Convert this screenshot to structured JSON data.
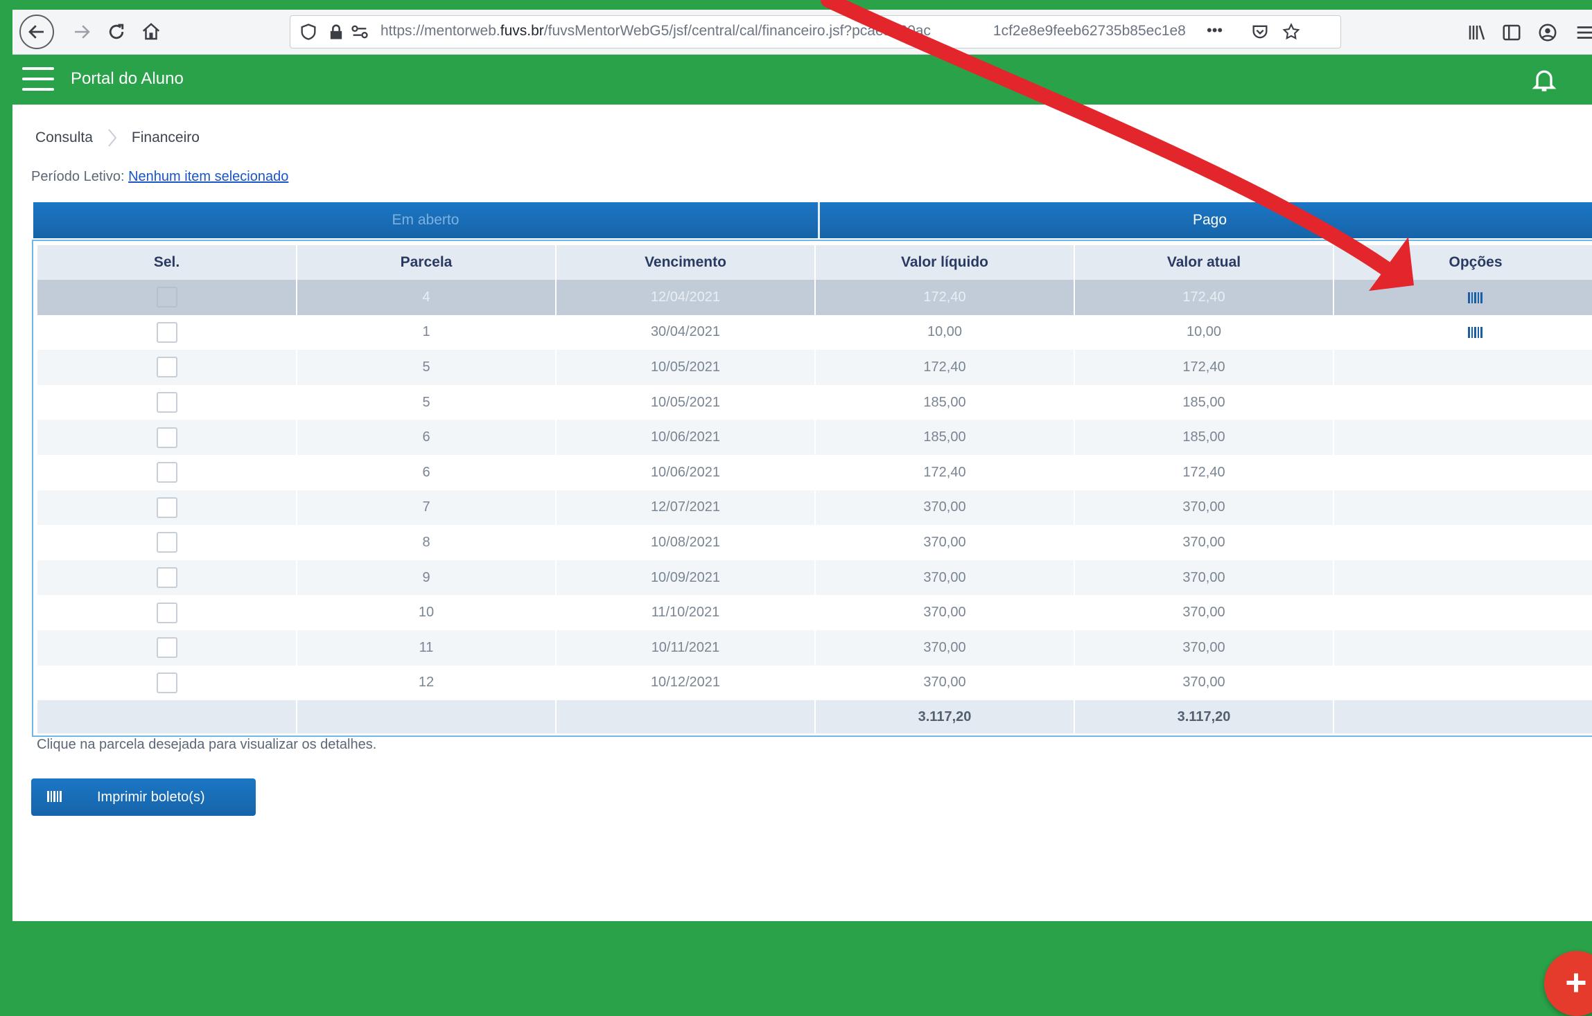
{
  "browser": {
    "url_prefix": "https://mentorweb.",
    "url_domain": "fuvs.br",
    "url_rest": "/fuvsMentorWebG5/jsf/central/cal/financeiro.jsf?pcaes=80ac",
    "url_tail": "1cf2e8e9feeb62735b85ec1e8",
    "menu_dots": "•••"
  },
  "app": {
    "title": "Portal do Aluno"
  },
  "breadcrumb": {
    "first": "Consulta",
    "second": "Financeiro"
  },
  "periodo": {
    "label": "Período Letivo:",
    "link": "Nenhum item selecionado"
  },
  "tabs": {
    "aberto": "Em aberto",
    "pago": "Pago"
  },
  "table": {
    "headers": {
      "sel": "Sel.",
      "parcela": "Parcela",
      "vencimento": "Vencimento",
      "liquido": "Valor líquido",
      "atual": "Valor atual",
      "opcoes": "Opções"
    },
    "rows": [
      {
        "parcela": "4",
        "vencimento": "12/04/2021",
        "liquido": "172,40",
        "atual": "172,40",
        "barcode": true
      },
      {
        "parcela": "1",
        "vencimento": "30/04/2021",
        "liquido": "10,00",
        "atual": "10,00",
        "barcode": true
      },
      {
        "parcela": "5",
        "vencimento": "10/05/2021",
        "liquido": "172,40",
        "atual": "172,40"
      },
      {
        "parcela": "5",
        "vencimento": "10/05/2021",
        "liquido": "185,00",
        "atual": "185,00"
      },
      {
        "parcela": "6",
        "vencimento": "10/06/2021",
        "liquido": "185,00",
        "atual": "185,00"
      },
      {
        "parcela": "6",
        "vencimento": "10/06/2021",
        "liquido": "172,40",
        "atual": "172,40"
      },
      {
        "parcela": "7",
        "vencimento": "12/07/2021",
        "liquido": "370,00",
        "atual": "370,00"
      },
      {
        "parcela": "8",
        "vencimento": "10/08/2021",
        "liquido": "370,00",
        "atual": "370,00"
      },
      {
        "parcela": "9",
        "vencimento": "10/09/2021",
        "liquido": "370,00",
        "atual": "370,00"
      },
      {
        "parcela": "10",
        "vencimento": "11/10/2021",
        "liquido": "370,00",
        "atual": "370,00"
      },
      {
        "parcela": "11",
        "vencimento": "10/11/2021",
        "liquido": "370,00",
        "atual": "370,00"
      },
      {
        "parcela": "12",
        "vencimento": "10/12/2021",
        "liquido": "370,00",
        "atual": "370,00"
      }
    ],
    "total_liquido": "3.117,20",
    "total_atual": "3.117,20"
  },
  "hint": "Clique na parcela desejada para visualizar os detalhes.",
  "print_button": "Imprimir boleto(s)",
  "colors": {
    "green": "#2aa24a",
    "blue": "#1a6bb8",
    "arrow": "#e3262b"
  }
}
